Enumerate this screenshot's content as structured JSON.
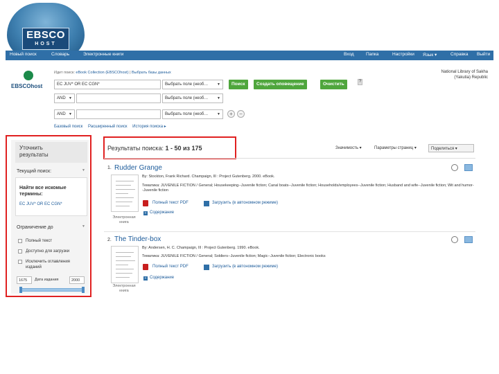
{
  "logo": {
    "brand": "EBSCO",
    "sub": "HOST"
  },
  "topnav": {
    "items": [
      "Новый поиск",
      "Словарь",
      "Электронные книги"
    ],
    "right_items": [
      "Вход",
      "Папка",
      "Настройки",
      "Язык ▾",
      "Справка",
      "Выйти"
    ]
  },
  "search": {
    "brand_small": "EBSCOhost",
    "searching_prefix": "Идет поиск:",
    "searching_db": "eBook Collection (EBSCOhost)",
    "choose_db": "Выбрать базы данных",
    "query": "EC JUV* OR EC CGN*",
    "field_label": "Выбрать поле (необ…",
    "bool_value": "AND",
    "search_button": "Поиск",
    "alert_button": "Создать оповещение",
    "clear_button": "Очистить",
    "help": "?",
    "add": "+",
    "remove": "−",
    "basic": "Базовый поиск",
    "advanced": "Расширенный поиск",
    "history": "История поиска ▸"
  },
  "institution": "National Library of Sakha (Yakutia) Republic",
  "sidebar": {
    "refine_title": "Уточнить результаты",
    "current_search": "Текущий поиск:",
    "find_all_label": "Найти все искомые термины:",
    "current_term": "EC JUV* OR EC CGN*",
    "limit_to": "Ограничение до",
    "checkboxes": [
      "Полный текст",
      "Доступно для загрузки",
      "Исключить оглавления изданий"
    ],
    "year_from": "1675",
    "year_mid": "Дата издания",
    "year_to": "2000"
  },
  "results": {
    "title_prefix": "Результаты поиска:",
    "title_range": "1 - 50 из 175",
    "sort": "Значимость ▾",
    "page_options": "Параметры страниц ▾",
    "share": "Поделиться ▾",
    "items": [
      {
        "num": "1.",
        "title": "Rudder Grange",
        "meta": "By: Stockton, Frank Richard. Champaign, Ill : Project Gutenberg. 2000. eBook.",
        "subjects": "Тематика: JUVENILE FICTION / General; Housekeeping--Juvenile fiction; Canal boats--Juvenile fiction; Households/employees--Juvenile fiction; Husband and wife--Juvenile fiction; Wit and humor--Juvenile fiction",
        "pdf": "Полный текст PDF",
        "download": "Загрузить (в автономном режиме)",
        "contents": "Содержание",
        "thumb_caption": "Электронная книга"
      },
      {
        "num": "2.",
        "title": "The Tinder-box",
        "meta": "By: Andersen, H. C. Champaign, Ill : Project Gutenberg. 1990. eBook.",
        "subjects": "Тематика: JUVENILE FICTION / General; Soldiers--Juvenile fiction; Magic--Juvenile fiction; Electronic books",
        "pdf": "Полный текст PDF",
        "download": "Загрузить (в автономном режиме)",
        "contents": "Содержание",
        "thumb_caption": "Электронная книга"
      }
    ]
  },
  "colors": {
    "nav": "#2f6fa7",
    "highlight_border": "#e02020",
    "button": "#4fa63d",
    "link": "#1c5b9a"
  }
}
